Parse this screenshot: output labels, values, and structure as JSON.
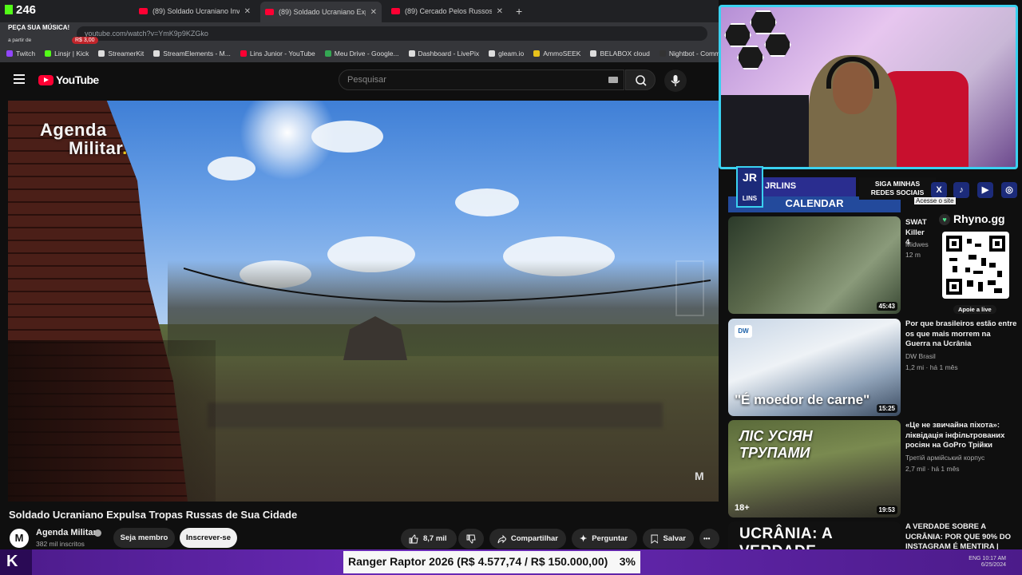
{
  "kick_overlay": {
    "viewer_count": "246",
    "song_request": "PEÇA SUA MÚSICA!",
    "from_label": "a partir de",
    "price": "R$ 3,00"
  },
  "browser": {
    "tabs": [
      {
        "label": "(89) Soldado Ucraniano Invade",
        "active": false
      },
      {
        "label": "(89) Soldado Ucraniano Exp",
        "active": true
      },
      {
        "label": "(89) Cercado Pelos Russos Esse",
        "active": false
      }
    ],
    "url": "youtube.com/watch?v=YmK9p9KZGko",
    "bookmarks": [
      {
        "label": "Twitch",
        "color": "#9146ff"
      },
      {
        "label": "Linsjr | Kick",
        "color": "#53fc18"
      },
      {
        "label": "StreamerKit",
        "color": "#dddddd"
      },
      {
        "label": "StreamElements - M...",
        "color": "#dddddd"
      },
      {
        "label": "Lins Junior - YouTube",
        "color": "#ff0033"
      },
      {
        "label": "Meu Drive - Google...",
        "color": "#34a853"
      },
      {
        "label": "Dashboard - LivePix",
        "color": "#dddddd"
      },
      {
        "label": "gleam.io",
        "color": "#dddddd"
      },
      {
        "label": "AmmoSEEK",
        "color": "#e8c21b"
      },
      {
        "label": "BELABOX cloud",
        "color": "#dddddd"
      },
      {
        "label": "Nightbot - Comm",
        "color": "#333333"
      }
    ]
  },
  "youtube": {
    "logo": "YouTube",
    "search_placeholder": "Pesquisar"
  },
  "video": {
    "overlay_line1": "Agenda",
    "overlay_line2": "Militar",
    "overlay_dot": ".",
    "watermark": "M",
    "title": "Soldado Ucraniano Expulsa Tropas Russas de Sua Cidade",
    "channel_avatar": "M",
    "channel_name": "Agenda Militar",
    "channel_subs": "382 mil inscritos",
    "join_label": "Seja membro",
    "subscribe_label": "Inscrever-se",
    "like_count": "8,7 mil",
    "share_label": "Compartilhar",
    "ask_label": "Perguntar",
    "save_label": "Salvar",
    "more_label": "•••"
  },
  "recommendations": [
    {
      "title": "SWAT Killer 4",
      "channel": "Midwes",
      "meta": "12 m",
      "duration": "45:43"
    },
    {
      "title": "Por que brasileiros estão entre os que mais morrem na Guerra na Ucrânia",
      "channel": "DW Brasil",
      "meta": "1,2 mi · há 1 mês",
      "duration": "15:25",
      "thumb_caption": "\"É moedor de carne\"",
      "badge": "DW"
    },
    {
      "title": "«Це не звичайна піхота»: ліквідація інфільтрованих росіян на GoPro Трійки",
      "channel": "Третій армійський корпус",
      "meta": "2,7 mil · há 1 mês",
      "duration": "19:53",
      "thumb_caption": "ЛІС УСІЯН ТРУПАМИ",
      "badge": "18+"
    },
    {
      "title": "A VERDADE SOBRE A UCRÂNIA: POR QUE 90% DO INSTAGRAM É MENTIRA |",
      "thumb_caption": "UCRÂNIA: A VERDADE"
    }
  ],
  "stream_overlay": {
    "jr_logo": "JR",
    "jr_sub": "LINS",
    "jrlins_text": "JRLINS",
    "siga_text": "SIGA MINHAS REDES SOCIAIS",
    "social_icons": [
      {
        "name": "x-icon",
        "glyph": "X"
      },
      {
        "name": "tiktok-icon",
        "glyph": "♪"
      },
      {
        "name": "youtube-icon",
        "glyph": "▶"
      },
      {
        "name": "instagram-icon",
        "glyph": "◎"
      }
    ],
    "calendar_text": "CALENDAR",
    "acesse_text": "Acesse o site",
    "rhyno_brand": "Rhyno.gg",
    "rhyno_cta": "Apoie a live"
  },
  "goal_bar": {
    "label": "Ranger Raptor 2026 (R$ 4.577,74 / R$ 150.000,00)",
    "percent_text": "3%",
    "percent_value": 3.05
  },
  "taskbar": {
    "lang": "ENG",
    "time": "10:17 AM",
    "date": "6/25/2024"
  }
}
